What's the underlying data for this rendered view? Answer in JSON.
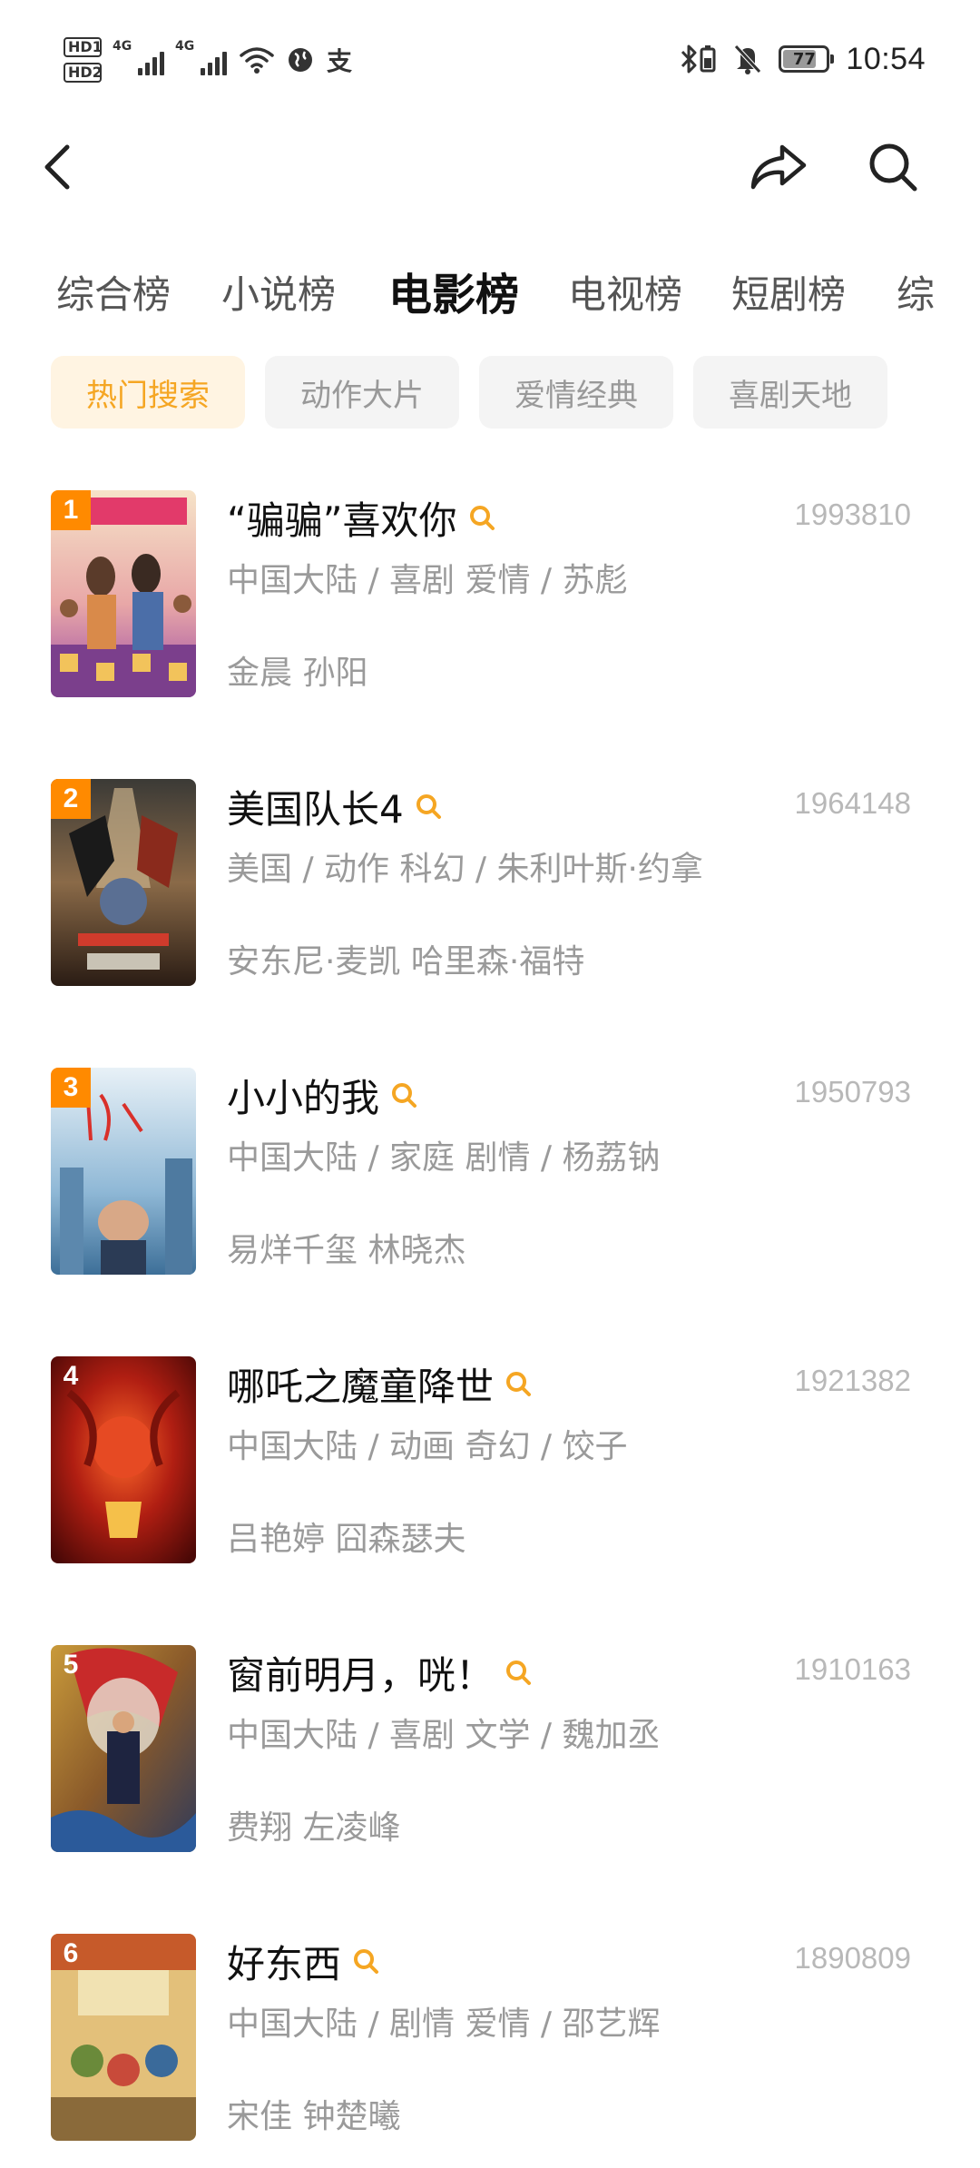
{
  "status_bar": {
    "hd1": "HD1",
    "hd2": "HD2",
    "net1": "4G",
    "net2": "4G",
    "alipay_glyph": "支",
    "battery": "77",
    "battery_fraction": 0.77,
    "time": "10:54"
  },
  "toolbar": {
    "back_icon": "chevron-left",
    "share_icon": "share-arrow",
    "search_icon": "magnifier"
  },
  "tabs": [
    {
      "label": "综合榜"
    },
    {
      "label": "小说榜"
    },
    {
      "label": "电影榜",
      "active": true
    },
    {
      "label": "电视榜"
    },
    {
      "label": "短剧榜"
    },
    {
      "label": "综"
    }
  ],
  "chips": [
    {
      "label": "热门搜索",
      "active": true
    },
    {
      "label": "动作大片"
    },
    {
      "label": "爱情经典"
    },
    {
      "label": "喜剧天地"
    }
  ],
  "colors": {
    "accent": "#f5a623",
    "rank_top": "#ff8a00",
    "rank_other": "#222222",
    "secondary_text": "#9a9a9a"
  },
  "movies": [
    {
      "rank": "1",
      "title": "“骗骗”喜欢你",
      "score": "1993810",
      "meta": "中国大陆 / 喜剧 爱情 / 苏彪",
      "cast": "金晨 孙阳"
    },
    {
      "rank": "2",
      "title": "美国队长4",
      "score": "1964148",
      "meta": "美国 / 动作 科幻 / 朱利叶斯·约拿",
      "cast": "安东尼·麦凯 哈里森·福特"
    },
    {
      "rank": "3",
      "title": "小小的我",
      "score": "1950793",
      "meta": "中国大陆 / 家庭 剧情 / 杨荔钠",
      "cast": "易烊千玺 林晓杰"
    },
    {
      "rank": "4",
      "title": "哪吒之魔童降世",
      "score": "1921382",
      "meta": "中国大陆 / 动画 奇幻 / 饺子",
      "cast": "吕艳婷 囧森瑟夫"
    },
    {
      "rank": "5",
      "title": "窗前明月，咣！",
      "score": "1910163",
      "meta": "中国大陆 / 喜剧 文学 / 魏加丞",
      "cast": "费翔 左凌峰"
    },
    {
      "rank": "6",
      "title": "好东西",
      "score": "1890809",
      "meta": "中国大陆 / 剧情 爱情 / 邵艺辉",
      "cast": "宋佳 钟楚曦"
    }
  ]
}
